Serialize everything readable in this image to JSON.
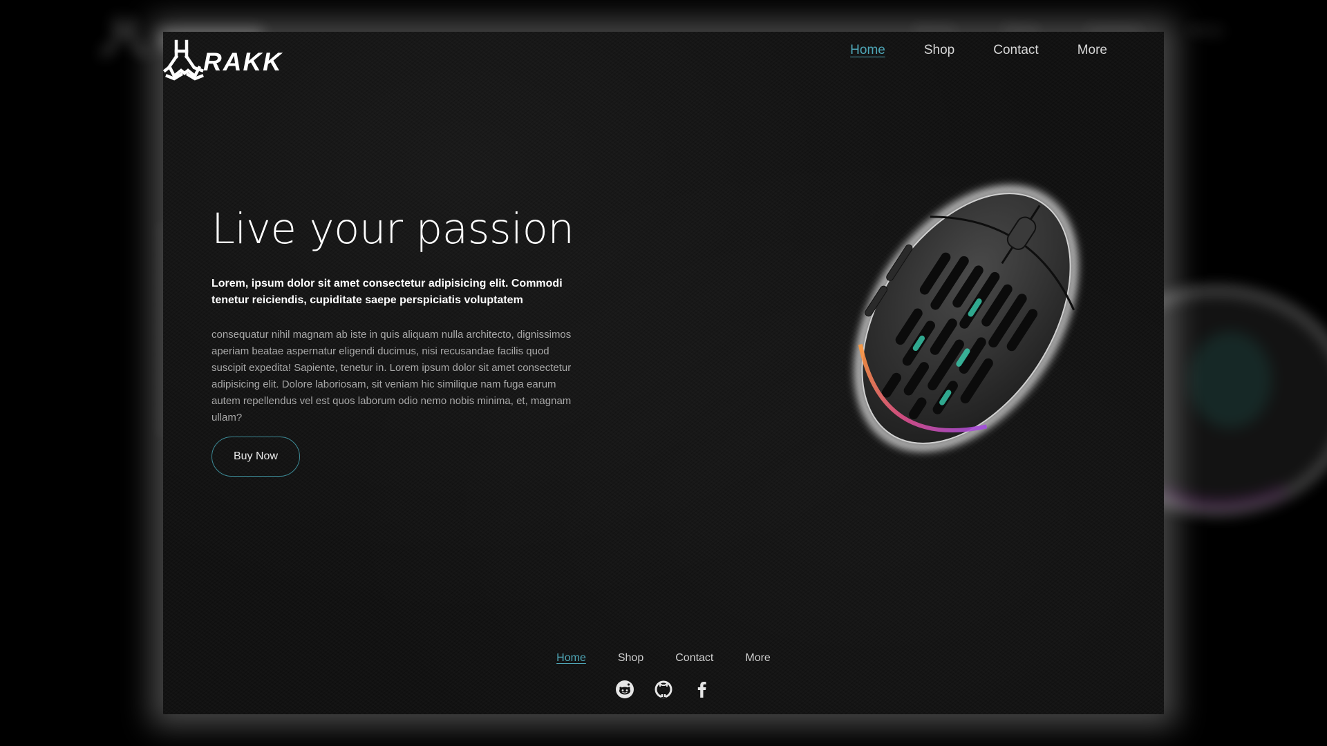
{
  "brand": {
    "name": "RAKK",
    "logo_icon": "rakk-logo-icon"
  },
  "nav": {
    "items": [
      {
        "label": "Home",
        "active": true
      },
      {
        "label": "Shop",
        "active": false
      },
      {
        "label": "Contact",
        "active": false
      },
      {
        "label": "More",
        "active": false
      }
    ]
  },
  "hero": {
    "title": "Live your passion",
    "lead": "Lorem, ipsum dolor sit amet consectetur adipisicing elit. Commodi tenetur reiciendis, cupiditate saepe perspiciatis voluptatem",
    "body": "consequatur nihil magnam ab iste in quis aliquam nulla architecto, dignissimos aperiam beatae aspernatur eligendi ducimus, nisi recusandae facilis quod suscipit expedita! Sapiente, tenetur in. Lorem ipsum dolor sit amet consectetur adipisicing elit. Dolore laboriosam, sit veniam hic similique nam fuga earum autem repellendus vel est quos laborum odio nemo nobis minima, et, magnam ullam?",
    "cta_label": "Buy Now",
    "product_image": "gaming-mouse-image"
  },
  "footer": {
    "nav": [
      {
        "label": "Home",
        "active": true
      },
      {
        "label": "Shop",
        "active": false
      },
      {
        "label": "Contact",
        "active": false
      },
      {
        "label": "More",
        "active": false
      }
    ],
    "social": [
      {
        "icon": "reddit-icon"
      },
      {
        "icon": "github-icon"
      },
      {
        "icon": "facebook-icon"
      }
    ]
  },
  "colors": {
    "accent": "#4fa7b8",
    "button_border": "#3c8a96",
    "background": "#121212",
    "text_primary": "#ffffff",
    "text_muted": "#a8a8a8"
  }
}
